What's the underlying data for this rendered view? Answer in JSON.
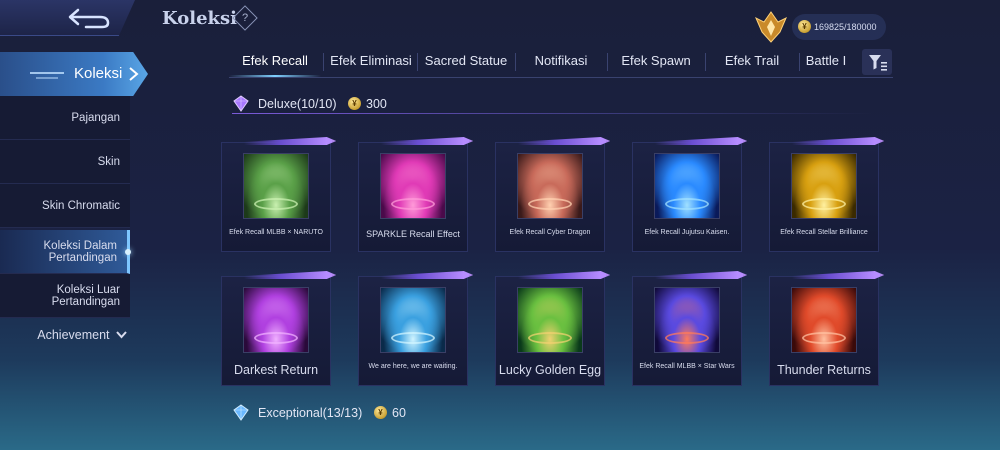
{
  "header": {
    "title": "Koleksi",
    "help_glyph": "?",
    "points": "169825/180000"
  },
  "sidebar": {
    "main_label": "Koleksi",
    "items": [
      {
        "label": "Pajangan"
      },
      {
        "label": "Skin"
      },
      {
        "label": "Skin Chromatic"
      },
      {
        "label_line1": "Koleksi Dalam",
        "label_line2": "Pertandingan"
      },
      {
        "label_line1": "Koleksi Luar",
        "label_line2": "Pertandingan"
      }
    ],
    "achievement_label": "Achievement"
  },
  "tabs": [
    {
      "label": "Efek Recall"
    },
    {
      "label": "Efek Eliminasi"
    },
    {
      "label": "Sacred Statue"
    },
    {
      "label": "Notifikasi"
    },
    {
      "label": "Efek Spawn"
    },
    {
      "label": "Efek Trail"
    },
    {
      "label": "Battle I"
    }
  ],
  "sections": [
    {
      "name": "Deluxe(10/10)",
      "coins": "300"
    },
    {
      "name": "Exceptional(13/13)",
      "coins": "60"
    }
  ],
  "items": [
    {
      "caption": "Efek Recall MLBB × NARUTO",
      "colors": [
        "#1d3a1a",
        "#5aa048",
        "#c9f0b0"
      ]
    },
    {
      "caption": "SPARKLE Recall Effect",
      "colors": [
        "#4a0a4a",
        "#e03ab6",
        "#ff9ad8"
      ]
    },
    {
      "caption": "Efek Recall Cyber Dragon",
      "colors": [
        "#3a1a1a",
        "#c86a5a",
        "#ffd0b0"
      ]
    },
    {
      "caption": "Efek Recall Jujutsu Kaisen.",
      "colors": [
        "#0a1a5a",
        "#2a8aff",
        "#a0e0ff"
      ]
    },
    {
      "caption": "Efek Recall Stellar Brilliance",
      "colors": [
        "#3a2a00",
        "#d8a010",
        "#fff0a0"
      ]
    },
    {
      "caption": "Darkest Return",
      "colors": [
        "#2a0a3a",
        "#b040e0",
        "#f0b0ff"
      ]
    },
    {
      "caption": "We are here, we are waiting.",
      "colors": [
        "#0a2a4a",
        "#3aa0e0",
        "#d0f4ff"
      ]
    },
    {
      "caption": "Lucky Golden Egg",
      "colors": [
        "#0a3a1a",
        "#6ac040",
        "#f0d070"
      ]
    },
    {
      "caption": "Efek Recall MLBB × Star Wars",
      "colors": [
        "#100a3a",
        "#5a4ae0",
        "#ff7a5a"
      ]
    },
    {
      "caption": "Thunder Returns",
      "colors": [
        "#3a0a0a",
        "#e04a2a",
        "#ffc0a0"
      ]
    }
  ]
}
